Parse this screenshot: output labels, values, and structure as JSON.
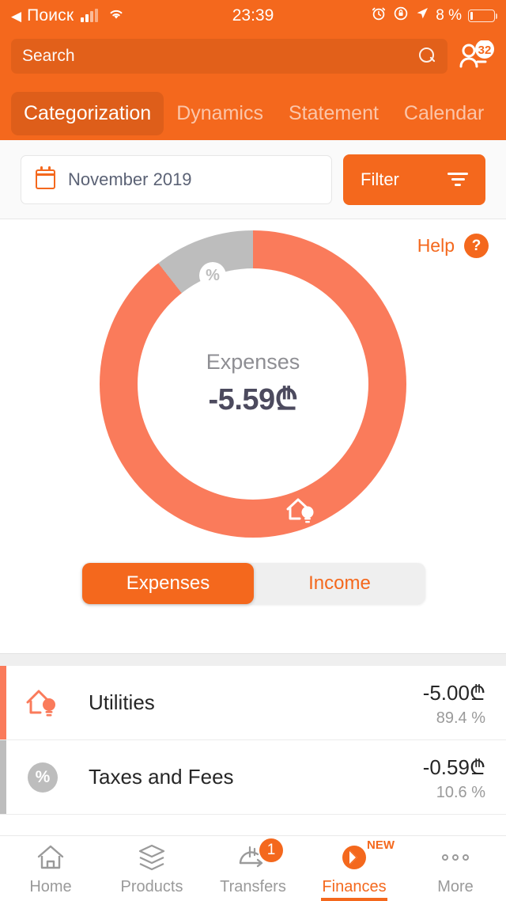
{
  "statusbar": {
    "back_label": "Поиск",
    "back_icon": "triangle-left-icon",
    "signal_icon": "signal-bars-icon",
    "wifi_icon": "wifi-icon",
    "time": "23:39",
    "alarm_icon": "alarm-clock-icon",
    "rotation_lock_icon": "rotation-lock-icon",
    "location_icon": "location-arrow-icon",
    "battery_percent": "8 %",
    "battery_icon": "battery-icon"
  },
  "header": {
    "search": {
      "placeholder": "Search",
      "icon": "search-icon"
    },
    "contacts": {
      "icon": "contacts-icon",
      "badge": "32"
    },
    "tabs": [
      {
        "label": "Categorization",
        "active": true
      },
      {
        "label": "Dynamics",
        "active": false
      },
      {
        "label": "Statement",
        "active": false
      },
      {
        "label": "Calendar",
        "active": false
      }
    ]
  },
  "filterbar": {
    "calendar_icon": "calendar-icon",
    "period": "November 2019",
    "filter_label": "Filter",
    "filter_icon": "filter-lines-icon"
  },
  "chart_card": {
    "help_label": "Help",
    "help_icon": "question-mark-icon",
    "center_title": "Expenses",
    "center_value": "-5.59₾",
    "segments_toggle": [
      {
        "label": "Expenses",
        "active": true
      },
      {
        "label": "Income",
        "active": false
      }
    ]
  },
  "chart_data": {
    "type": "pie",
    "title": "Expenses",
    "subtitle": "-5.59₾",
    "currency": "₾",
    "total": -5.59,
    "donut": true,
    "start_angle_deg": 0,
    "categories": [
      "Utilities",
      "Taxes and Fees"
    ],
    "values": [
      5.0,
      0.59
    ],
    "percentages": [
      89.4,
      10.6
    ],
    "labels": [
      "-5.00₾",
      "-0.59₾"
    ],
    "colors": [
      "#FA7B5B",
      "#BDBDBD"
    ],
    "slice_icons": [
      "house-bulb-icon",
      "percent-icon"
    ],
    "legend": "none"
  },
  "list": {
    "rows": [
      {
        "icon": "house-bulb-icon",
        "label": "Utilities",
        "amount": "-5.00₾",
        "percent": "89.4 %",
        "color": "#FA7B5B"
      },
      {
        "icon": "percent-icon",
        "label": "Taxes and Fees",
        "amount": "-0.59₾",
        "percent": "10.6 %",
        "color": "#BDBDBD"
      }
    ]
  },
  "tabbar": {
    "items": [
      {
        "label": "Home",
        "icon": "home-icon",
        "active": false,
        "badge": "",
        "tag": ""
      },
      {
        "label": "Products",
        "icon": "layers-icon",
        "active": false,
        "badge": "",
        "tag": ""
      },
      {
        "label": "Transfers",
        "icon": "transfer-icon",
        "active": false,
        "badge": "1",
        "tag": ""
      },
      {
        "label": "Finances",
        "icon": "finances-icon",
        "active": true,
        "badge": "",
        "tag": "NEW"
      },
      {
        "label": "More",
        "icon": "more-dots-icon",
        "active": false,
        "badge": "",
        "tag": ""
      }
    ]
  },
  "colors": {
    "brand_orange": "#F4681D",
    "chart_orange": "#FA7B5B",
    "chart_gray": "#BDBDBD",
    "text_dark": "#262626",
    "text_muted": "#9A9A9A"
  }
}
